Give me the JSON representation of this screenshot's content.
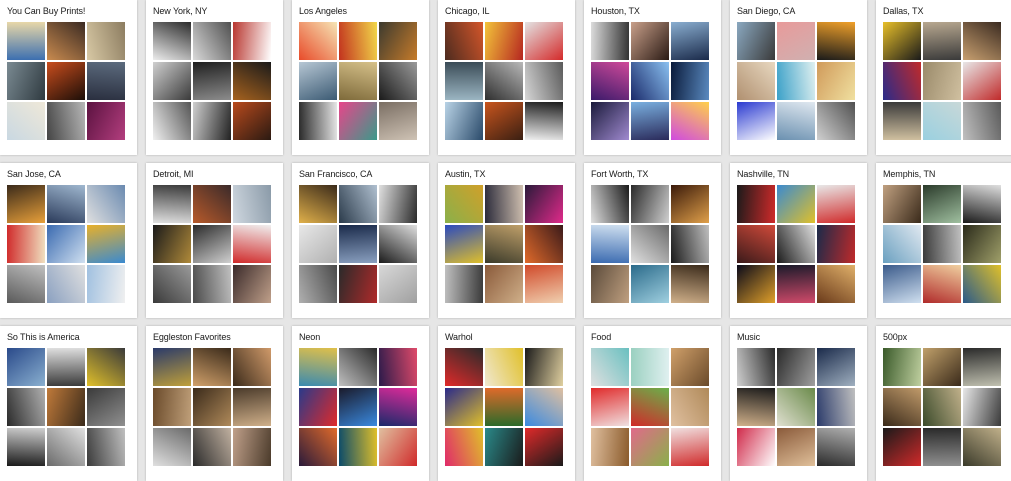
{
  "collections": [
    {
      "title": "You Can Buy Prints!",
      "tiles": [
        [
          "#3c6fb0",
          "#e8d7a8"
        ],
        [
          "#c98b4f",
          "#3a2a22"
        ],
        [
          "#d8c9a5",
          "#8c7c60"
        ],
        [
          "#7a8a92",
          "#2f3a40"
        ],
        [
          "#c94d1d",
          "#1c0e08"
        ],
        [
          "#2a2f3f",
          "#5c6b7e"
        ],
        [
          "#c9d8e2",
          "#efe8d8"
        ],
        [
          "#444",
          "#b7b7b7"
        ],
        [
          "#5b1240",
          "#b33e7e"
        ]
      ]
    },
    {
      "title": "New York, NY",
      "tiles": [
        [
          "#ededed",
          "#2b2b2b"
        ],
        [
          "#d9d9d9",
          "#505050"
        ],
        [
          "#b8362f",
          "#ffffff"
        ],
        [
          "#d0d0d0",
          "#3a3a3a"
        ],
        [
          "#1f1f1f",
          "#8c8c8c"
        ],
        [
          "#a6621e",
          "#1a1a1a"
        ],
        [
          "#f0f0f0",
          "#555"
        ],
        [
          "#cfcfcf",
          "#222"
        ],
        [
          "#b84a1d",
          "#2b1a12"
        ]
      ]
    },
    {
      "title": "Los Angeles",
      "tiles": [
        [
          "#e84b2a",
          "#f6e5b5"
        ],
        [
          "#c2321e",
          "#f2d84a"
        ],
        [
          "#3c3a2f",
          "#c67b2a"
        ],
        [
          "#b7c7d4",
          "#3b5a73"
        ],
        [
          "#7e6a3a",
          "#d6c18a"
        ],
        [
          "#1a1a1a",
          "#9a9a9a"
        ],
        [
          "#2a2a2a",
          "#e6e6e6"
        ],
        [
          "#e8458a",
          "#3a9a8a"
        ],
        [
          "#7a6e63",
          "#cfc3b5"
        ]
      ]
    },
    {
      "title": "Chicago, IL",
      "tiles": [
        [
          "#4c2b1f",
          "#d4562a"
        ],
        [
          "#f3c43a",
          "#b52620"
        ],
        [
          "#e3e3e3",
          "#d42a2a"
        ],
        [
          "#9bb5c2",
          "#3b4c57"
        ],
        [
          "#2f2f2f",
          "#b8b8b8"
        ],
        [
          "#d6d6d6",
          "#5a5a5a"
        ],
        [
          "#b9d3e6",
          "#2a4a6a"
        ],
        [
          "#c9551e",
          "#3a1f12"
        ],
        [
          "#f0f0f0",
          "#1c1c1c"
        ]
      ]
    },
    {
      "title": "Houston, TX",
      "tiles": [
        [
          "#dcdcdc",
          "#333"
        ],
        [
          "#c9a08a",
          "#2a1a14"
        ],
        [
          "#8aaed0",
          "#1a2a4a"
        ],
        [
          "#3a1a6a",
          "#d04a9a"
        ],
        [
          "#1a2a6a",
          "#8ac0f0"
        ],
        [
          "#0a1a3a",
          "#5a8ac0"
        ],
        [
          "#1a1a3a",
          "#a08ad0"
        ],
        [
          "#7ab0e0",
          "#2a2a5a"
        ],
        [
          "#d04ae0",
          "#ffd04a"
        ]
      ]
    },
    {
      "title": "San Diego, CA",
      "tiles": [
        [
          "#8aa8c0",
          "#3a3a3a"
        ],
        [
          "#e89a9a",
          "#d0b0b0"
        ],
        [
          "#1a1a1a",
          "#f0a02a"
        ],
        [
          "#b09070",
          "#e8d8c0"
        ],
        [
          "#3aa0c8",
          "#e0f0f0"
        ],
        [
          "#d09a5a",
          "#f0e0a0"
        ],
        [
          "#2a3ad0",
          "#ffffff"
        ],
        [
          "#6a90b0",
          "#e0e8f0"
        ],
        [
          "#d0d0d0",
          "#505050"
        ]
      ]
    },
    {
      "title": "Dallas, TX",
      "tiles": [
        [
          "#e8c02a",
          "#1a1a1a"
        ],
        [
          "#b8a890",
          "#3a3a3a"
        ],
        [
          "#c8a070",
          "#3a2a20"
        ],
        [
          "#2a2a8a",
          "#c02a2a"
        ],
        [
          "#9a8a6a",
          "#d0c0a0"
        ],
        [
          "#e8e8e8",
          "#c02a2a"
        ],
        [
          "#d0c0a0",
          "#3a3a3a"
        ],
        [
          "#9ad0e0",
          "#c8d8d8"
        ],
        [
          "#c0c0c0",
          "#5a5a5a"
        ]
      ]
    },
    {
      "title": "San Jose, CA",
      "tiles": [
        [
          "#3a2a1a",
          "#e8a03a"
        ],
        [
          "#2a3a5a",
          "#a0b8d0"
        ],
        [
          "#e0e0e0",
          "#6a8ab0"
        ],
        [
          "#d02a2a",
          "#f0e0c0"
        ],
        [
          "#3a6ab0",
          "#d0e0f0"
        ],
        [
          "#e8b02a",
          "#3a8ad0"
        ],
        [
          "#5a5a5a",
          "#c0c0c0"
        ],
        [
          "#8aa0c0",
          "#e0e0e0"
        ],
        [
          "#a0c0e0",
          "#f0f0f0"
        ]
      ]
    },
    {
      "title": "Detroit, MI",
      "tiles": [
        [
          "#e0e0e0",
          "#3a3a3a"
        ],
        [
          "#b85a2a",
          "#3a2a2a"
        ],
        [
          "#d0d8e0",
          "#8a9aa8"
        ],
        [
          "#1a1a1a",
          "#b08a3a"
        ],
        [
          "#2a2a2a",
          "#d0d0d0"
        ],
        [
          "#d02a2a",
          "#f0f0f0"
        ],
        [
          "#3a3a3a",
          "#9a9a9a"
        ],
        [
          "#4a4a4a",
          "#c0c0c0"
        ],
        [
          "#3a2a2a",
          "#c0a08a"
        ]
      ]
    },
    {
      "title": "San Francisco, CA",
      "tiles": [
        [
          "#e0b04a",
          "#3a2a1a"
        ],
        [
          "#2a3a4a",
          "#b0c0d0"
        ],
        [
          "#e0e0e0",
          "#2a2a2a"
        ],
        [
          "#e8e8e8",
          "#b0b0b0"
        ],
        [
          "#1a2a4a",
          "#8aa0c0"
        ],
        [
          "#1a1a1a",
          "#e0e0e0"
        ],
        [
          "#b0b0b0",
          "#4a4a4a"
        ],
        [
          "#2a2a2a",
          "#b02a2a"
        ],
        [
          "#d8d8d8",
          "#a0a0a0"
        ]
      ]
    },
    {
      "title": "Austin, TX",
      "tiles": [
        [
          "#8ab04a",
          "#d0a02a"
        ],
        [
          "#2a2a3a",
          "#d0c0b0"
        ],
        [
          "#2a1a3a",
          "#e02a8a"
        ],
        [
          "#2a4ac0",
          "#e0c02a"
        ],
        [
          "#3a3a2a",
          "#c0a06a"
        ],
        [
          "#e06a2a",
          "#3a1a1a"
        ],
        [
          "#c0c0c0",
          "#3a3a3a"
        ],
        [
          "#8a5a3a",
          "#d0b08a"
        ],
        [
          "#d04a2a",
          "#f0d0b0"
        ]
      ]
    },
    {
      "title": "Fort Worth, TX",
      "tiles": [
        [
          "#e0e0e0",
          "#1a1a1a"
        ],
        [
          "#2a2a2a",
          "#d0d0d0"
        ],
        [
          "#3a1a0a",
          "#e0a04a"
        ],
        [
          "#3a6ab0",
          "#d0e0f0"
        ],
        [
          "#e0e0e0",
          "#6a6a6a"
        ],
        [
          "#1a1a1a",
          "#c0c0c0"
        ],
        [
          "#5a4a3a",
          "#c0a080"
        ],
        [
          "#2a6a8a",
          "#a0d0e0"
        ],
        [
          "#d0b08a",
          "#3a2a1a"
        ]
      ]
    },
    {
      "title": "Nashville, TN",
      "tiles": [
        [
          "#1a1a1a",
          "#d02a2a"
        ],
        [
          "#3a8ad0",
          "#e0c02a"
        ],
        [
          "#e8e8e8",
          "#d02a2a"
        ],
        [
          "#3a1a1a",
          "#d04a3a"
        ],
        [
          "#1a1a1a",
          "#e0e0e0"
        ],
        [
          "#1a2a4a",
          "#c02a2a"
        ],
        [
          "#0a0a1a",
          "#e0a02a"
        ],
        [
          "#1a1a2a",
          "#d04a6a"
        ],
        [
          "#6a3a1a",
          "#e0b06a"
        ]
      ]
    },
    {
      "title": "Memphis, TN",
      "tiles": [
        [
          "#c0a080",
          "#3a2a1a"
        ],
        [
          "#2a3a2a",
          "#a0c0a0"
        ],
        [
          "#1a1a1a",
          "#e0e0e0"
        ],
        [
          "#6aa0c0",
          "#e0e8f0"
        ],
        [
          "#3a3a3a",
          "#c0c0c0"
        ],
        [
          "#2a2a1a",
          "#a0a06a"
        ],
        [
          "#3a5a8a",
          "#d0e0f0"
        ],
        [
          "#b02a2a",
          "#f0d0a0"
        ],
        [
          "#2a5a8a",
          "#e0c02a"
        ]
      ]
    },
    {
      "title": "So This is America",
      "tiles": [
        [
          "#2a4a8a",
          "#8ab0d0"
        ],
        [
          "#e0e0e0",
          "#3a3a3a"
        ],
        [
          "#e0c02a",
          "#3a3a3a"
        ],
        [
          "#2a2a2a",
          "#b0b0b0"
        ],
        [
          "#c07a3a",
          "#3a2a1a"
        ],
        [
          "#3a3a3a",
          "#909090"
        ],
        [
          "#1a1a1a",
          "#d0d0d0"
        ],
        [
          "#6a6a6a",
          "#e0e0e0"
        ],
        [
          "#3a3a3a",
          "#c0c0c0"
        ]
      ]
    },
    {
      "title": "Eggleston Favorites",
      "tiles": [
        [
          "#2a3a6a",
          "#c0a03a"
        ],
        [
          "#d0a06a",
          "#3a2a1a"
        ],
        [
          "#3a2a1a",
          "#d09a6a"
        ],
        [
          "#6a4a2a",
          "#c0a07a"
        ],
        [
          "#3a2a1a",
          "#b08a5a"
        ],
        [
          "#4a3a2a",
          "#d0b08a"
        ],
        [
          "#e0e0e0",
          "#6a6a6a"
        ],
        [
          "#2a2a2a",
          "#c0b0a0"
        ],
        [
          "#c0a08a",
          "#4a3a2a"
        ]
      ]
    },
    {
      "title": "Neon",
      "tiles": [
        [
          "#3a8ab0",
          "#e0c04a"
        ],
        [
          "#c0c0c0",
          "#2a2a2a"
        ],
        [
          "#2a1a4a",
          "#e04a6a"
        ],
        [
          "#2a3a8a",
          "#e02a2a"
        ],
        [
          "#1a1a2a",
          "#3a8ae0"
        ],
        [
          "#1a2a6a",
          "#e02a9a"
        ],
        [
          "#2a1a3a",
          "#e06a2a"
        ],
        [
          "#0a4a6a",
          "#e0c02a"
        ],
        [
          "#e0c0a0",
          "#d02a2a"
        ]
      ]
    },
    {
      "title": "Warhol",
      "tiles": [
        [
          "#e02a2a",
          "#2a2a2a"
        ],
        [
          "#f0e8d0",
          "#e0c02a"
        ],
        [
          "#1a1a1a",
          "#e0d0a0"
        ],
        [
          "#2a2a8a",
          "#e0c02a"
        ],
        [
          "#e06a2a",
          "#2a6a2a"
        ],
        [
          "#3a8ae0",
          "#e0c0a0"
        ],
        [
          "#e02a6a",
          "#e0c02a"
        ],
        [
          "#2a8a8a",
          "#1a1a1a"
        ],
        [
          "#e02a2a",
          "#1a1a1a"
        ]
      ]
    },
    {
      "title": "Food",
      "tiles": [
        [
          "#e0e0e0",
          "#6ac0c0"
        ],
        [
          "#9ad0c0",
          "#e0f0f0"
        ],
        [
          "#d0a06a",
          "#6a4a2a"
        ],
        [
          "#e02a2a",
          "#f0e0e0"
        ],
        [
          "#d02a2a",
          "#6ab04a"
        ],
        [
          "#e0c0a0",
          "#b08a5a"
        ],
        [
          "#e0c0a0",
          "#8a5a2a"
        ],
        [
          "#e06a8a",
          "#8ab04a"
        ],
        [
          "#f0e0e0",
          "#d02a2a"
        ]
      ]
    },
    {
      "title": "Music",
      "tiles": [
        [
          "#d0d0d0",
          "#2a2a2a"
        ],
        [
          "#2a2a2a",
          "#a0a0a0"
        ],
        [
          "#1a2a4a",
          "#a0b0c0"
        ],
        [
          "#d0b08a",
          "#1a1a1a"
        ],
        [
          "#e0e0d0",
          "#6a8a4a"
        ],
        [
          "#2a3a6a",
          "#c0c0c0"
        ],
        [
          "#d02a4a",
          "#ffffff"
        ],
        [
          "#8a5a3a",
          "#e0c09a"
        ],
        [
          "#2a2a2a",
          "#b0b0b0"
        ]
      ]
    },
    {
      "title": "500px",
      "tiles": [
        [
          "#3a5a2a",
          "#c0d0a0"
        ],
        [
          "#c0a06a",
          "#3a2a1a"
        ],
        [
          "#2a2a2a",
          "#c0c0b0"
        ],
        [
          "#3a2a1a",
          "#c09a6a"
        ],
        [
          "#3a4a2a",
          "#c0b08a"
        ],
        [
          "#e8e8e8",
          "#3a3a3a"
        ],
        [
          "#1a1a1a",
          "#d02a2a"
        ],
        [
          "#2a2a2a",
          "#909090"
        ],
        [
          "#3a3a2a",
          "#c0b08a"
        ]
      ]
    }
  ]
}
